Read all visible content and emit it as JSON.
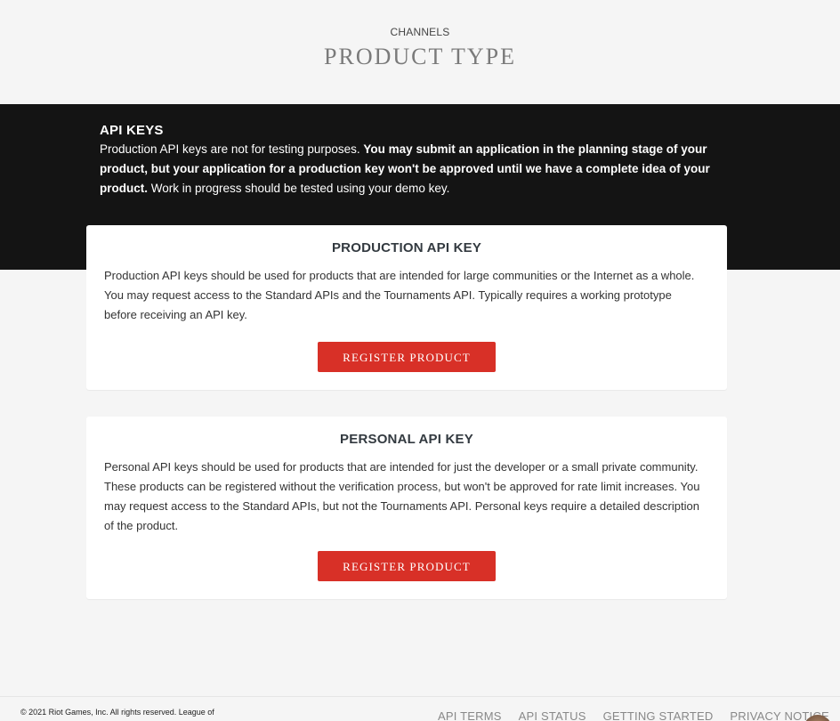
{
  "header": {
    "kicker": "CHANNELS",
    "title": "PRODUCT TYPE"
  },
  "api_keys_banner": {
    "heading": "API KEYS",
    "text_normal_1": "Production API keys are not for testing purposes. ",
    "text_bold": "You may submit an application in the planning stage of your product, but your application for a production key won't be approved until we have a complete idea of your product.",
    "text_normal_2": " Work in progress should be tested using your demo key."
  },
  "cards": [
    {
      "title": "PRODUCTION API KEY",
      "body": "Production API keys should be used for products that are intended for large communities or the Internet as a whole. You may request access to the Standard APIs and the Tournaments API. Typically requires a working prototype before receiving an API key.",
      "button_label": "REGISTER PRODUCT"
    },
    {
      "title": "PERSONAL API KEY",
      "body": "Personal API keys should be used for products that are intended for just the developer or a small private community. These products can be registered without the verification process, but won't be approved for rate limit increases. You may request access to the Standard APIs, but not the Tournaments API. Personal keys require a detailed description of the product.",
      "button_label": "REGISTER PRODUCT"
    }
  ],
  "footer": {
    "copyright": "© 2021 Riot Games, Inc. All rights reserved. League of",
    "links": [
      "API TERMS",
      "API STATUS",
      "GETTING STARTED",
      "PRIVACY NOTICE"
    ]
  },
  "colors": {
    "accent_button": "#d83027",
    "band_background": "#141414",
    "page_background": "#f5f5f5"
  }
}
